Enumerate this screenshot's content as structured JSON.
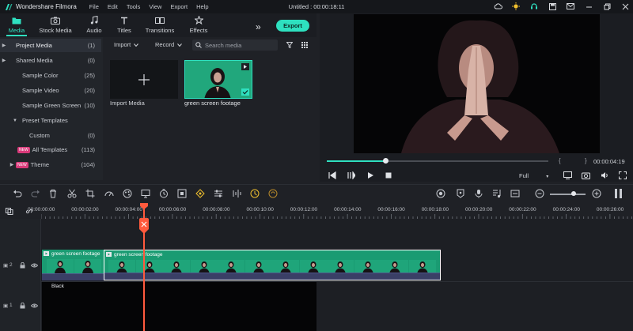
{
  "app": {
    "name": "Wondershare Filmora",
    "menu": [
      "File",
      "Edit",
      "Tools",
      "View",
      "Export",
      "Help"
    ],
    "project_title": "Untitled : 00:00:18:11",
    "accent_color": "#2fe0c0",
    "window_icons": [
      "cloud-icon",
      "lightbulb-icon",
      "headset-icon",
      "save-icon",
      "mail-icon",
      "minimize-icon",
      "restore-icon",
      "close-icon"
    ]
  },
  "tabs": [
    {
      "label": "Media",
      "icon": "media-folder-icon",
      "active": true
    },
    {
      "label": "Stock Media",
      "icon": "camera-icon"
    },
    {
      "label": "Audio",
      "icon": "music-note-icon"
    },
    {
      "label": "Titles",
      "icon": "text-icon"
    },
    {
      "label": "Transitions",
      "icon": "transition-icon"
    },
    {
      "label": "Effects",
      "icon": "effects-icon"
    }
  ],
  "export_label": "Export",
  "sidebar": {
    "items": [
      {
        "label": "Project Media",
        "count": "(1)",
        "caret": "▶",
        "selected": true
      },
      {
        "label": "Shared Media",
        "count": "(0)",
        "caret": "▶"
      },
      {
        "label": "Sample Color",
        "count": "(25)"
      },
      {
        "label": "Sample Video",
        "count": "(20)"
      },
      {
        "label": "Sample Green Screen",
        "count": "(10)"
      },
      {
        "label": "Preset Templates",
        "count": "",
        "caret": "▼"
      },
      {
        "label": "Custom",
        "count": "(0)"
      },
      {
        "label": "All Templates",
        "count": "(113)",
        "badge": "NEW"
      },
      {
        "label": "Theme",
        "count": "(104)",
        "caret": "▶",
        "badge": "NEW"
      }
    ]
  },
  "media_toolbar": {
    "import_label": "Import",
    "record_label": "Record",
    "search_placeholder": "Search media"
  },
  "media_items": [
    {
      "label": "Import Media"
    },
    {
      "label": "green screen footage"
    }
  ],
  "preview": {
    "progress": 0.265,
    "time": "00:00:04:19",
    "quality": "Full",
    "braces": "{ }"
  },
  "ruler": {
    "labels": [
      "00:00:00:00",
      "00:00:02:00",
      "00:00:04:00",
      "00:00:06:00",
      "00:00:08:00",
      "00:00:10:00",
      "00:00:12:00",
      "00:00:14:00",
      "00:00:16:00",
      "00:00:18:00",
      "00:00:20:00",
      "00:00:22:00",
      "00:00:24:00",
      "00:00:26:00"
    ]
  },
  "tracks": {
    "video_track_label": "2",
    "black_track_label": "1",
    "clip1_title": "green screen footage",
    "clip2_title": "green screen footage",
    "black_clip_title": "Black"
  }
}
